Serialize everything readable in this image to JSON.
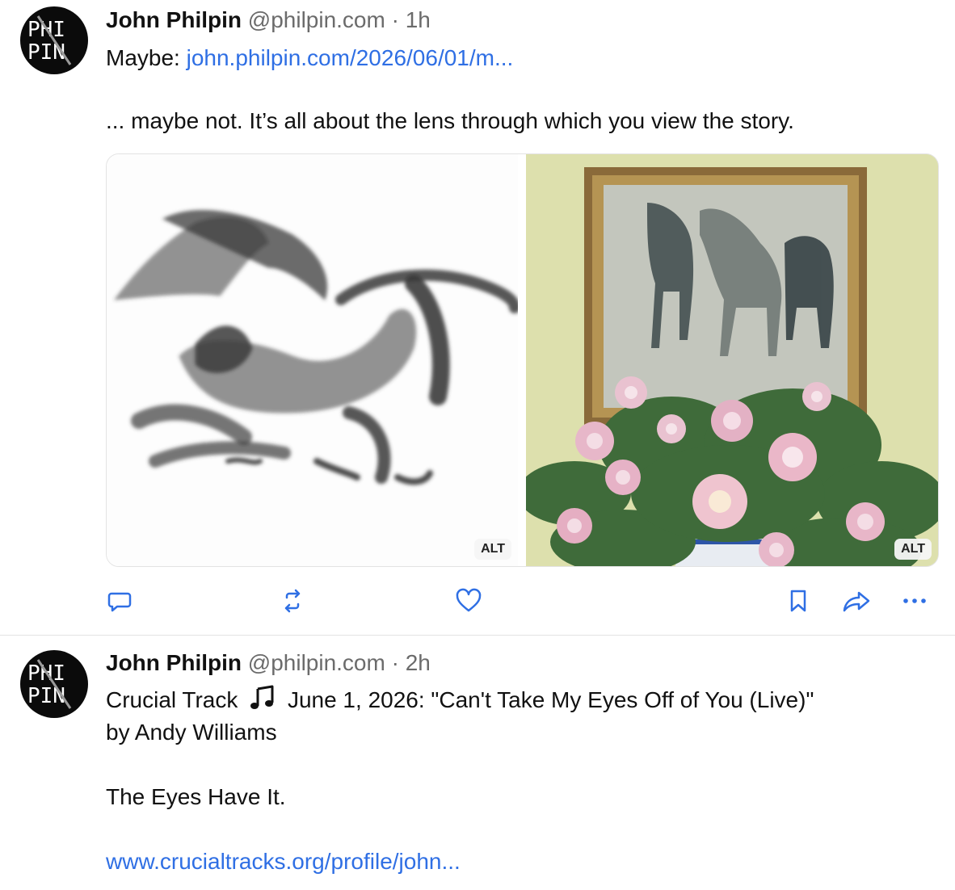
{
  "posts": [
    {
      "avatar": {
        "line1": "PHI",
        "line2": "PIN"
      },
      "author_name": "John Philpin",
      "handle": "@philpin.com",
      "separator": "·",
      "time": "1h",
      "text_prefix": "Maybe:",
      "link_text": "john.philpin.com/2026/06/01/m...",
      "body": "... maybe not. It’s all about the lens through which you view the story.",
      "images": [
        {
          "alt_badge": "ALT"
        },
        {
          "alt_badge": "ALT"
        }
      ],
      "actions": [
        "reply-icon",
        "repost-icon",
        "like-icon",
        "bookmark-icon",
        "share-icon",
        "more-icon"
      ]
    },
    {
      "avatar": {
        "line1": "PHI",
        "line2": "PIN"
      },
      "author_name": "John Philpin",
      "handle": "@philpin.com",
      "separator": "·",
      "time": "2h",
      "line1_before_note": "Crucial Track",
      "note_icon": "music-note-icon",
      "line1_after_note": "June 1, 2026: \"Can't Take My Eyes Off of You (Live)\"",
      "line2": "by Andy Williams",
      "line3": "The Eyes Have It.",
      "link_text": "www.crucialtracks.org/profile/john..."
    }
  ],
  "colors": {
    "link": "#2f6fe4",
    "muted": "#6b6b6b",
    "divider": "#e3e3e3"
  }
}
